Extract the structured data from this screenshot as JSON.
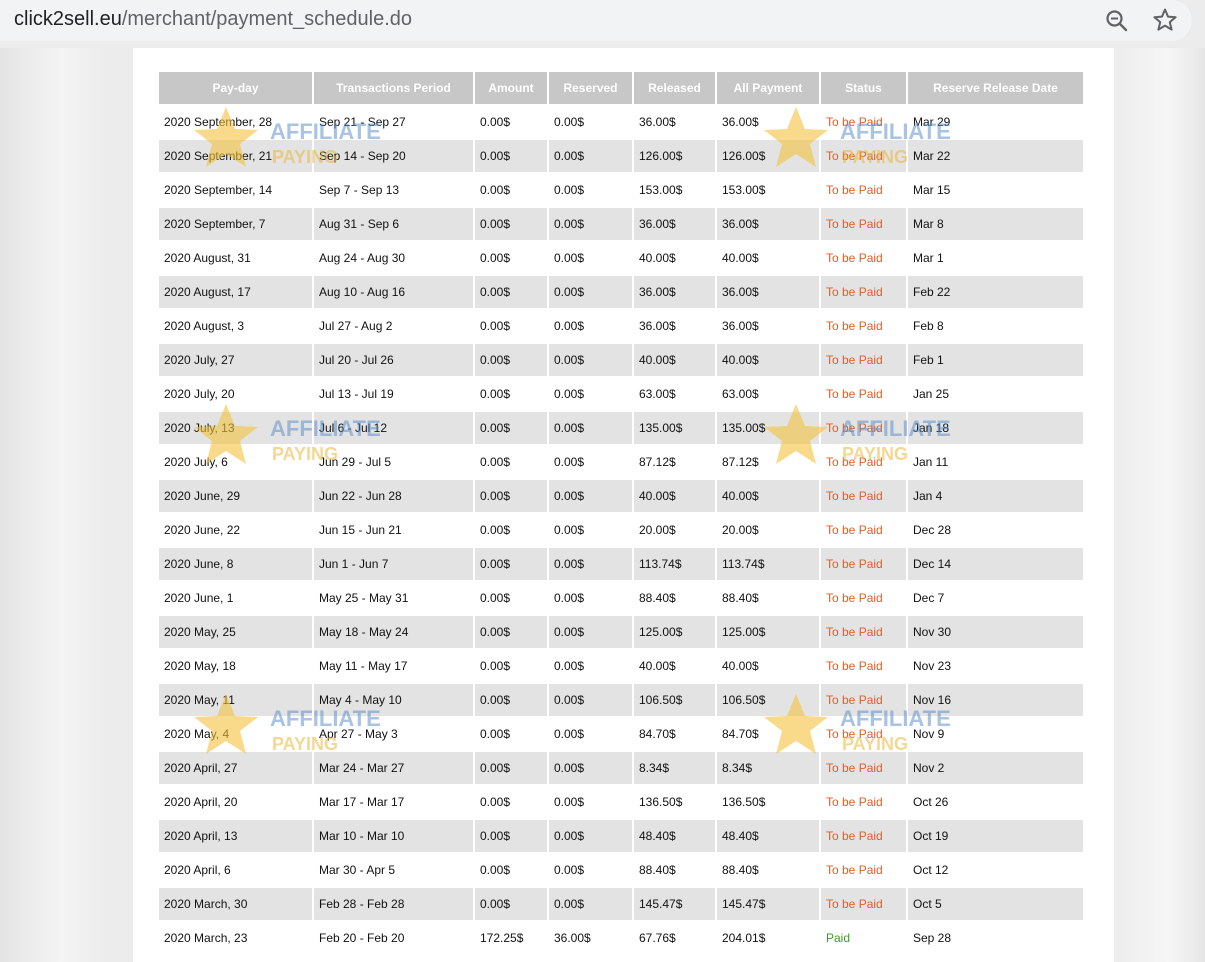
{
  "browser": {
    "url_domain": "click2sell.eu",
    "url_path": "/merchant/payment_schedule.do",
    "zoom_icon": "zoom-magnifier-icon",
    "bookmark_icon": "star-icon"
  },
  "colors": {
    "to_be_paid": "#d9602b",
    "paid": "#3f9a2e",
    "header_bg": "#c7c7c7",
    "row_alt": "#e3e3e3"
  },
  "table": {
    "headers": [
      "Pay-day",
      "Transactions Period",
      "Amount",
      "Reserved",
      "Released",
      "All Payment",
      "Status",
      "Reserve Release Date"
    ],
    "rows": [
      [
        "2020 September, 28",
        "Sep 21 - Sep 27",
        "0.00$",
        "0.00$",
        "36.00$",
        "36.00$",
        "To be Paid",
        "Mar 29"
      ],
      [
        "2020 September, 21",
        "Sep 14 - Sep 20",
        "0.00$",
        "0.00$",
        "126.00$",
        "126.00$",
        "To be Paid",
        "Mar 22"
      ],
      [
        "2020 September, 14",
        "Sep 7 - Sep 13",
        "0.00$",
        "0.00$",
        "153.00$",
        "153.00$",
        "To be Paid",
        "Mar 15"
      ],
      [
        "2020 September, 7",
        "Aug 31 - Sep 6",
        "0.00$",
        "0.00$",
        "36.00$",
        "36.00$",
        "To be Paid",
        "Mar 8"
      ],
      [
        "2020 August, 31",
        "Aug 24 - Aug 30",
        "0.00$",
        "0.00$",
        "40.00$",
        "40.00$",
        "To be Paid",
        "Mar 1"
      ],
      [
        "2020 August, 17",
        "Aug 10 - Aug 16",
        "0.00$",
        "0.00$",
        "36.00$",
        "36.00$",
        "To be Paid",
        "Feb 22"
      ],
      [
        "2020 August, 3",
        "Jul 27 - Aug 2",
        "0.00$",
        "0.00$",
        "36.00$",
        "36.00$",
        "To be Paid",
        "Feb 8"
      ],
      [
        "2020 July, 27",
        "Jul 20 - Jul 26",
        "0.00$",
        "0.00$",
        "40.00$",
        "40.00$",
        "To be Paid",
        "Feb 1"
      ],
      [
        "2020 July, 20",
        "Jul 13 - Jul 19",
        "0.00$",
        "0.00$",
        "63.00$",
        "63.00$",
        "To be Paid",
        "Jan 25"
      ],
      [
        "2020 July, 13",
        "Jul 6 - Jul 12",
        "0.00$",
        "0.00$",
        "135.00$",
        "135.00$",
        "To be Paid",
        "Jan 18"
      ],
      [
        "2020 July, 6",
        "Jun 29 - Jul 5",
        "0.00$",
        "0.00$",
        "87.12$",
        "87.12$",
        "To be Paid",
        "Jan 11"
      ],
      [
        "2020 June, 29",
        "Jun 22 - Jun 28",
        "0.00$",
        "0.00$",
        "40.00$",
        "40.00$",
        "To be Paid",
        "Jan 4"
      ],
      [
        "2020 June, 22",
        "Jun 15 - Jun 21",
        "0.00$",
        "0.00$",
        "20.00$",
        "20.00$",
        "To be Paid",
        "Dec 28"
      ],
      [
        "2020 June, 8",
        "Jun 1 - Jun 7",
        "0.00$",
        "0.00$",
        "113.74$",
        "113.74$",
        "To be Paid",
        "Dec 14"
      ],
      [
        "2020 June, 1",
        "May 25 - May 31",
        "0.00$",
        "0.00$",
        "88.40$",
        "88.40$",
        "To be Paid",
        "Dec 7"
      ],
      [
        "2020 May, 25",
        "May 18 - May 24",
        "0.00$",
        "0.00$",
        "125.00$",
        "125.00$",
        "To be Paid",
        "Nov 30"
      ],
      [
        "2020 May, 18",
        "May 11 - May 17",
        "0.00$",
        "0.00$",
        "40.00$",
        "40.00$",
        "To be Paid",
        "Nov 23"
      ],
      [
        "2020 May, 11",
        "May 4 - May 10",
        "0.00$",
        "0.00$",
        "106.50$",
        "106.50$",
        "To be Paid",
        "Nov 16"
      ],
      [
        "2020 May, 4",
        "Apr 27 - May 3",
        "0.00$",
        "0.00$",
        "84.70$",
        "84.70$",
        "To be Paid",
        "Nov 9"
      ],
      [
        "2020 April, 27",
        "Mar 24 - Mar 27",
        "0.00$",
        "0.00$",
        "8.34$",
        "8.34$",
        "To be Paid",
        "Nov 2"
      ],
      [
        "2020 April, 20",
        "Mar 17 - Mar 17",
        "0.00$",
        "0.00$",
        "136.50$",
        "136.50$",
        "To be Paid",
        "Oct 26"
      ],
      [
        "2020 April, 13",
        "Mar 10 - Mar 10",
        "0.00$",
        "0.00$",
        "48.40$",
        "48.40$",
        "To be Paid",
        "Oct 19"
      ],
      [
        "2020 April, 6",
        "Mar 30 - Apr 5",
        "0.00$",
        "0.00$",
        "88.40$",
        "88.40$",
        "To be Paid",
        "Oct 12"
      ],
      [
        "2020 March, 30",
        "Feb 28 - Feb 28",
        "0.00$",
        "0.00$",
        "145.47$",
        "145.47$",
        "To be Paid",
        "Oct 5"
      ],
      [
        "2020 March, 23",
        "Feb 20 - Feb 20",
        "172.25$",
        "36.00$",
        "67.76$",
        "204.01$",
        "Paid",
        "Sep 28"
      ]
    ]
  },
  "watermark": {
    "line1": "AFFILIATE",
    "line2": "PAYING",
    "icon": "star-logo-icon"
  }
}
